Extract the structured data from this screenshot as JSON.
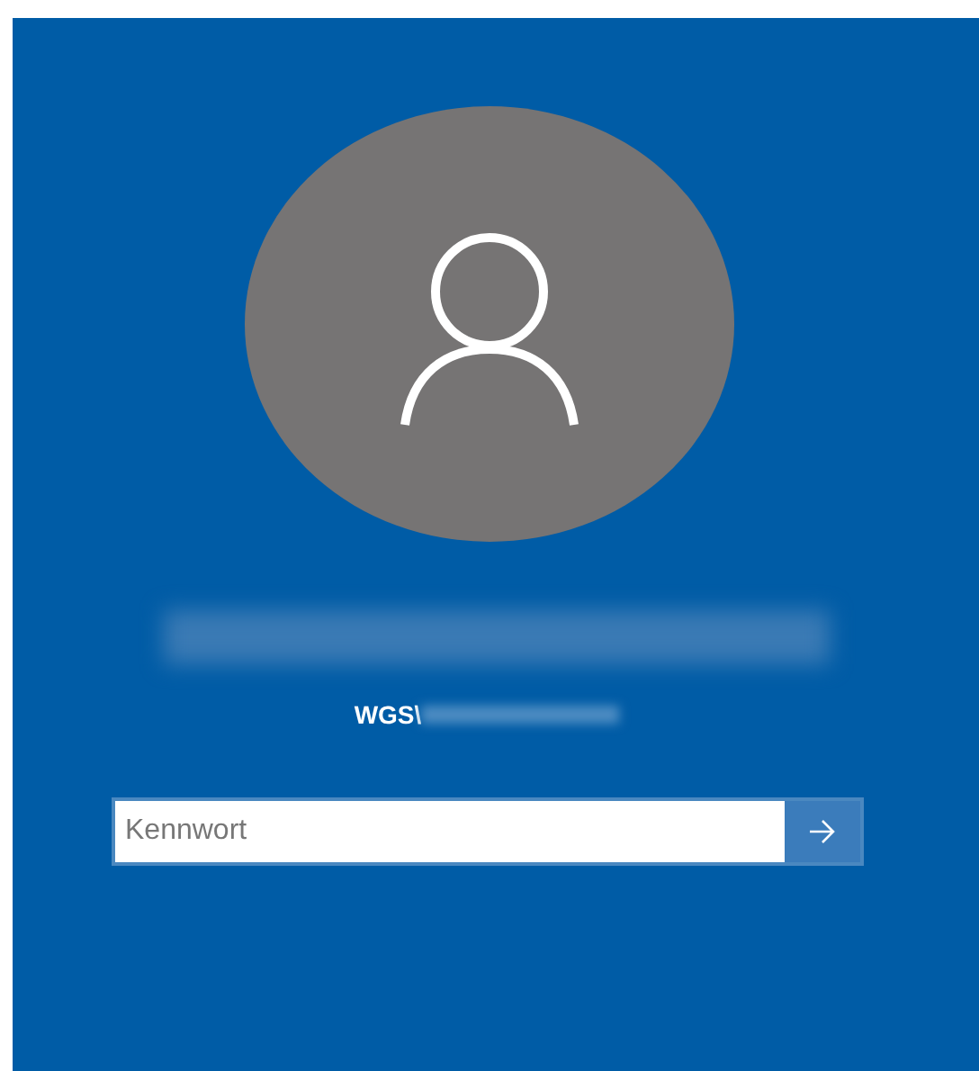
{
  "user": {
    "name_redacted": true
  },
  "account": {
    "domain": "WGS\\",
    "username_redacted": true
  },
  "password": {
    "placeholder": "Kennwort"
  }
}
